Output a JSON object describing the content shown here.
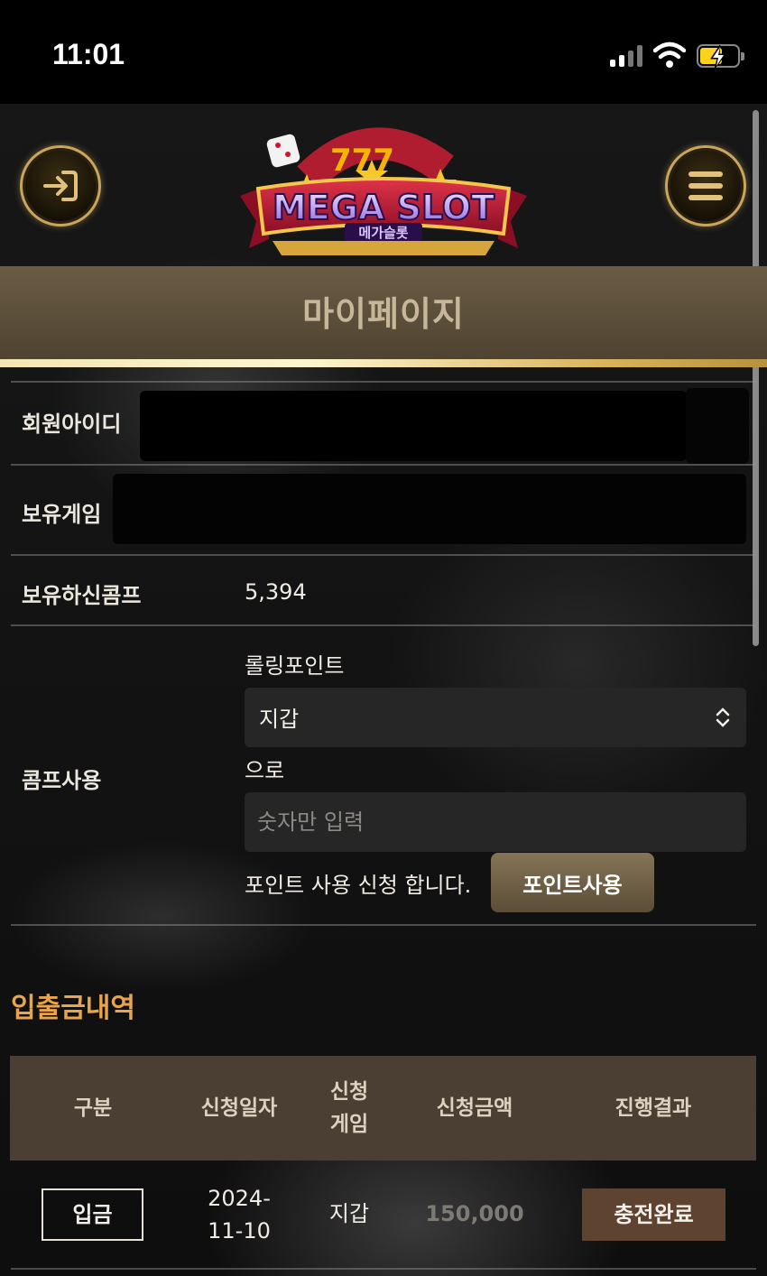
{
  "status_bar": {
    "time": "11:01"
  },
  "header": {
    "logo_text": "MEGA SLOT",
    "logo_subtext": "메가슬롯",
    "logo_reels": "777"
  },
  "page_title": "마이페이지",
  "profile": {
    "member_id_label": "회원아이디",
    "member_id_value": "",
    "game_label": "보유게임",
    "game_value": "",
    "comp_label": "보유하신콤프",
    "comp_value": "5,394"
  },
  "comp_use": {
    "label": "콤프사용",
    "prefix_text": "롤링포인트",
    "wallet_select_value": "지갑",
    "suffix_text": "으로",
    "amount_placeholder": "숫자만 입력",
    "apply_text": "포인트 사용 신청 합니다.",
    "button_label": "포인트사용"
  },
  "history": {
    "title": "입출금내역",
    "columns": [
      "구분",
      "신청일자",
      "신청\n게임",
      "신청금액",
      "진행결과"
    ],
    "rows": [
      {
        "type": "입금",
        "date": "2024-\n11-10",
        "game": "지갑",
        "amount": "150,000",
        "status": "충전완료"
      }
    ]
  },
  "colors": {
    "accent_gold": "#c9a65c",
    "title_band": "#5d503b",
    "section_title": "#e8a54b",
    "status_badge": "#5d4330",
    "battery_charge": "#ffd21e"
  }
}
